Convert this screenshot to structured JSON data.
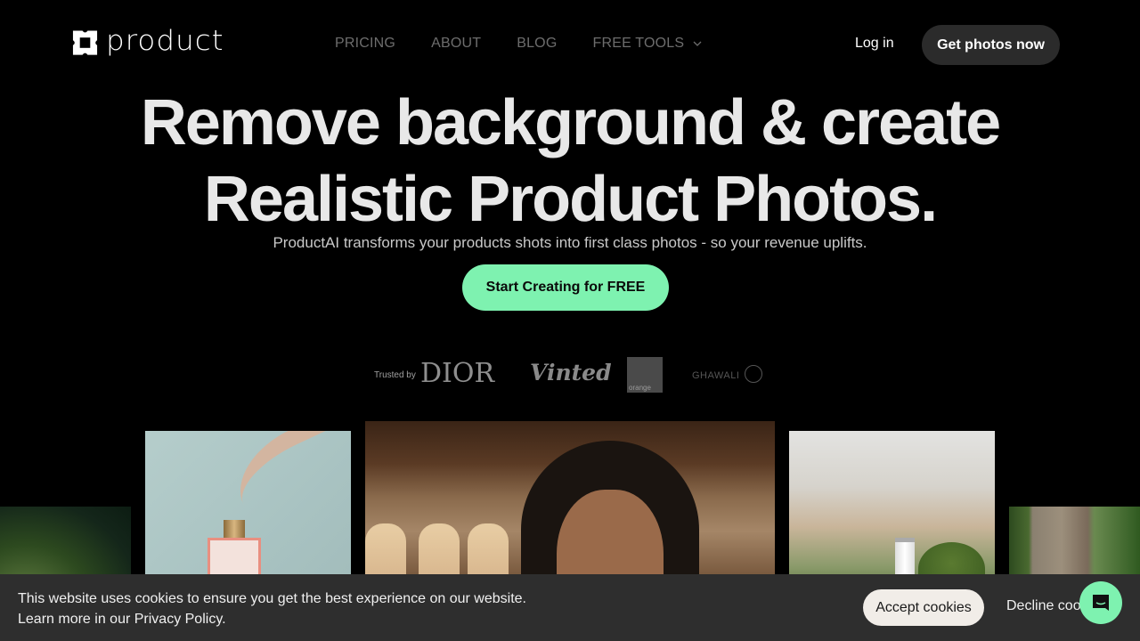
{
  "header": {
    "logo_text": "product",
    "logo_icon": "clover-square-icon",
    "nav": [
      {
        "label": "PRICING"
      },
      {
        "label": "ABOUT"
      },
      {
        "label": "BLOG"
      },
      {
        "label": "FREE TOOLS",
        "has_dropdown": true
      }
    ],
    "login_label": "Log in",
    "get_photos_label": "Get photos now"
  },
  "hero": {
    "title_line1": "Remove background & create",
    "title_line2": "Realistic Product Photos.",
    "subtitle": "ProductAI transforms your products shots into first class photos - so your revenue uplifts.",
    "cta_label": "Start Creating for FREE",
    "cta_color": "#7ef2b0"
  },
  "trusted": {
    "label": "Trusted by",
    "brands": [
      "DIOR",
      "Vinted",
      "orange",
      "GHAWALI"
    ]
  },
  "gallery": [
    {
      "name": "forest-photo"
    },
    {
      "name": "perfume-photo"
    },
    {
      "name": "portrait-photo"
    },
    {
      "name": "spray-bottle-photo"
    },
    {
      "name": "garden-photo"
    }
  ],
  "cookie_banner": {
    "line1": "This website uses cookies to ensure you get the best experience on our website.",
    "line2": "Learn more in our Privacy Policy.",
    "accept_label": "Accept cookies",
    "decline_label": "Decline cookies"
  },
  "chat_widget": {
    "icon": "chat-bubble-icon",
    "color": "#7ef2b0"
  }
}
